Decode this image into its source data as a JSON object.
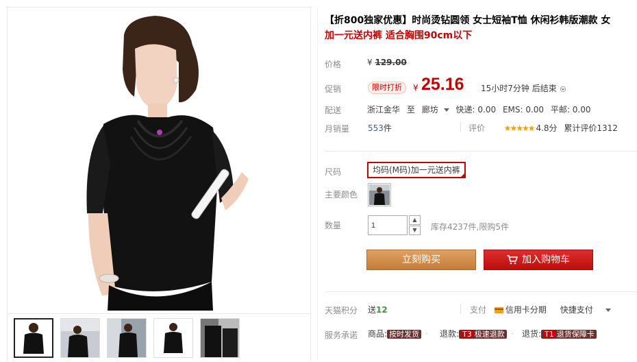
{
  "title": {
    "line1": "【折800独家优惠】时尚烫钻圆领 女士短袖T恤 休闲衫韩版潮款 女",
    "line2": "加一元送内裤 适合胸围90cm以下"
  },
  "price": {
    "label": "价格",
    "currency": "¥",
    "original": "129.00"
  },
  "promo": {
    "label": "促销",
    "badge": "限时打折",
    "currency": "¥",
    "price": "25.16",
    "countdown": "15小时7分钟 后结束"
  },
  "shipping": {
    "label": "配送",
    "from": "浙江金华",
    "to_word": "至",
    "to": "廊坊",
    "express": "快递: 0.00",
    "ems": "EMS: 0.00",
    "mail": "平邮: 0.00"
  },
  "sales": {
    "label": "月销量",
    "count": "553",
    "unit": "件",
    "review_label": "评价",
    "stars": "★★★★★",
    "score": "4.8分",
    "total_reviews": "累计评价1312"
  },
  "size": {
    "label": "尺码",
    "selected": "均码(M码)加一元送内裤"
  },
  "color": {
    "label": "主要颜色"
  },
  "quantity": {
    "label": "数量",
    "value": "1",
    "stock": "库存4237件,限购5件"
  },
  "buttons": {
    "buy": "立刻购买",
    "cart": "加入购物车"
  },
  "points": {
    "label": "天猫积分",
    "prefix": "送",
    "value": "12"
  },
  "payment": {
    "label": "支付",
    "credit": "信用卡分期",
    "express": "快捷支付"
  },
  "service": {
    "label": "服务承诺",
    "goods": "商品:",
    "goods_tag": "按时发货",
    "refund": "退款:",
    "refund_code": "T3",
    "refund_tag": "极速退款",
    "return": "退货:",
    "return_code": "T1",
    "return_tag": "退货保障卡"
  },
  "colors": {
    "accent": "#c40000",
    "buy_button": "#cf8a46",
    "cart_button": "#c40000",
    "stars": "#f0a000",
    "points": "#3c9a3c"
  }
}
